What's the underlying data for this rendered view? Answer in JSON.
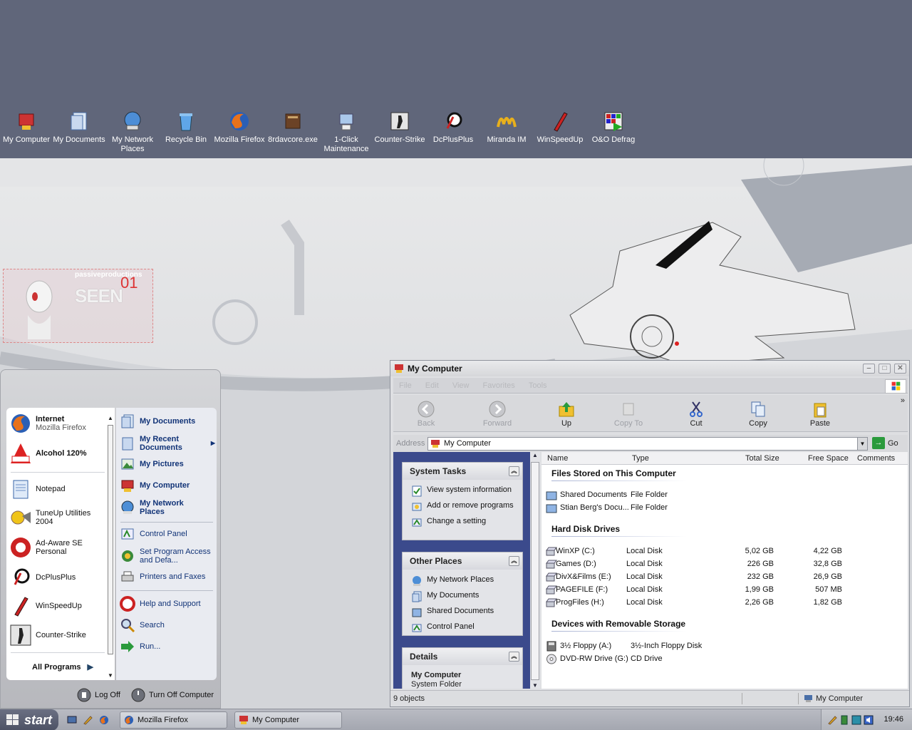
{
  "desktop": {
    "icons": [
      {
        "label": "My Computer",
        "icon": "my-computer-icon"
      },
      {
        "label": "My Documents",
        "icon": "my-documents-icon"
      },
      {
        "label": "My Network Places",
        "icon": "network-places-icon"
      },
      {
        "label": "Recycle Bin",
        "icon": "recycle-bin-icon"
      },
      {
        "label": "Mozilla Firefox",
        "icon": "firefox-icon"
      },
      {
        "label": "8rdavcore.exe",
        "icon": "book-icon"
      },
      {
        "label": "1-Click Maintenance",
        "icon": "maintenance-icon"
      },
      {
        "label": "Counter-Strike",
        "icon": "counter-strike-icon"
      },
      {
        "label": "DcPlusPlus",
        "icon": "dcplusplus-icon"
      },
      {
        "label": "Miranda IM",
        "icon": "miranda-icon"
      },
      {
        "label": "WinSpeedUp",
        "icon": "winspeedup-icon"
      },
      {
        "label": "O&O Defrag",
        "icon": "defrag-icon"
      }
    ],
    "widget": {
      "line1": "passiveproductions",
      "line2": "SEEN",
      "line3": "01"
    }
  },
  "start_menu": {
    "pinned": [
      {
        "title": "Internet",
        "sub": "Mozilla Firefox"
      },
      {
        "title": "Alcohol 120%",
        "sub": ""
      }
    ],
    "recent": [
      {
        "title": "Notepad"
      },
      {
        "title": "TuneUp Utilities 2004"
      },
      {
        "title": "Ad-Aware SE Personal"
      },
      {
        "title": "DcPlusPlus"
      },
      {
        "title": "WinSpeedUp"
      },
      {
        "title": "Counter-Strike"
      }
    ],
    "all_programs": "All Programs",
    "places": [
      {
        "label": "My Documents"
      },
      {
        "label": "My Recent Documents"
      },
      {
        "label": "My Pictures"
      },
      {
        "label": "My Computer"
      },
      {
        "label": "My Network Places"
      }
    ],
    "settings": [
      {
        "label": "Control Panel"
      },
      {
        "label": "Set Program Access and Defa..."
      },
      {
        "label": "Printers and Faxes"
      }
    ],
    "tools": [
      {
        "label": "Help and Support"
      },
      {
        "label": "Search"
      },
      {
        "label": "Run..."
      }
    ],
    "log_off": "Log Off",
    "turn_off": "Turn Off Computer"
  },
  "explorer": {
    "title": "My Computer",
    "menu": [
      "File",
      "Edit",
      "View",
      "Favorites",
      "Tools"
    ],
    "toolbar": {
      "back": "Back",
      "forward": "Forward",
      "up": "Up",
      "copy_to": "Copy To",
      "cut": "Cut",
      "copy": "Copy",
      "paste": "Paste"
    },
    "address_label": "Address",
    "address_value": "My Computer",
    "go": "Go",
    "system_tasks": {
      "title": "System Tasks",
      "items": [
        "View system information",
        "Add or remove programs",
        "Change a setting"
      ]
    },
    "other_places": {
      "title": "Other Places",
      "items": [
        "My Network Places",
        "My Documents",
        "Shared Documents",
        "Control Panel"
      ]
    },
    "details": {
      "title": "Details",
      "name": "My Computer",
      "type": "System Folder"
    },
    "columns": [
      "Name",
      "Type",
      "Total Size",
      "Free Space",
      "Comments"
    ],
    "groups": {
      "stored": "Files Stored on This Computer",
      "drives": "Hard Disk Drives",
      "removable": "Devices with Removable Storage"
    },
    "stored_items": [
      {
        "name": "Shared Documents",
        "type": "File Folder"
      },
      {
        "name": "Stian Berg's Docu...",
        "type": "File Folder"
      }
    ],
    "drives": [
      {
        "name": "WinXP (C:)",
        "type": "Local Disk",
        "total": "5,02 GB",
        "free": "4,22 GB"
      },
      {
        "name": "Games (D:)",
        "type": "Local Disk",
        "total": "226 GB",
        "free": "32,8 GB"
      },
      {
        "name": "DivX&Films (E:)",
        "type": "Local Disk",
        "total": "232 GB",
        "free": "26,9 GB"
      },
      {
        "name": "PAGEFILE (F:)",
        "type": "Local Disk",
        "total": "1,99 GB",
        "free": "507 MB"
      },
      {
        "name": "ProgFiles (H:)",
        "type": "Local Disk",
        "total": "2,26 GB",
        "free": "1,82 GB"
      }
    ],
    "removable": [
      {
        "name": "3½ Floppy (A:)",
        "type": "3½-Inch Floppy Disk"
      },
      {
        "name": "DVD-RW Drive (G:)",
        "type": "CD Drive"
      }
    ],
    "status_left": "9 objects",
    "status_right": "My Computer"
  },
  "taskbar": {
    "start": "start",
    "buttons": [
      "Mozilla Firefox",
      "My Computer"
    ],
    "clock": "19:46"
  },
  "colors": {
    "desktop": "#60667a",
    "sidebar": "#3b4a8c",
    "link": "#113377"
  }
}
